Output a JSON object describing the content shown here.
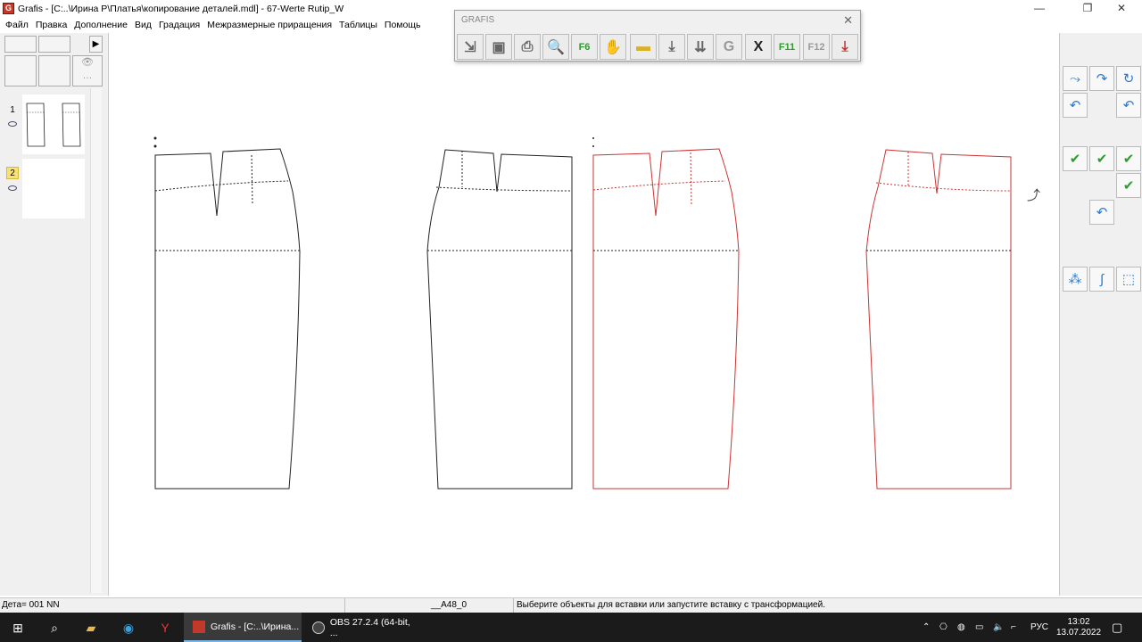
{
  "window": {
    "title": "Grafis - [C:..\\Ирина Р\\Платья\\копирование деталей.mdl] - 67-Werte Rutip_W",
    "app_icon_letter": "G",
    "minimize": "—",
    "restore": "❐",
    "close": "✕"
  },
  "menu": [
    "Файл",
    "Правка",
    "Дополнение",
    "Вид",
    "Градация",
    "Межразмерные приращения",
    "Таблицы",
    "Помощь"
  ],
  "left_panel": {
    "details": [
      {
        "number": "1"
      },
      {
        "number": "2"
      }
    ]
  },
  "toolbar": {
    "title": "GRAFIS",
    "close": "✕",
    "buttons": [
      {
        "icon": "insert-icon",
        "glyph": "⇲"
      },
      {
        "icon": "save-icon",
        "glyph": "▣"
      },
      {
        "icon": "print-icon",
        "glyph": "⎙"
      },
      {
        "icon": "zoom-icon",
        "glyph": "🔍"
      },
      {
        "icon": "fit-f6-icon",
        "glyph": "F6"
      },
      {
        "icon": "hand-icon",
        "glyph": "✋"
      },
      {
        "icon": "ruler-icon",
        "glyph": "▬"
      },
      {
        "icon": "move-down-icon",
        "glyph": "⤓"
      },
      {
        "icon": "move-all-down-icon",
        "glyph": "⇊"
      },
      {
        "icon": "group-icon",
        "glyph": "G"
      },
      {
        "icon": "excel-icon",
        "glyph": "X"
      },
      {
        "icon": "f11-icon",
        "glyph": "F11"
      },
      {
        "icon": "f12-icon",
        "glyph": "F12"
      },
      {
        "icon": "exit-icon",
        "glyph": "⤓"
      }
    ]
  },
  "right_panel": {
    "buttons": [
      {
        "name": "transform-points-button",
        "glyph": "⤳"
      },
      {
        "name": "transform-line-button",
        "glyph": "↷"
      },
      {
        "name": "transform-contour-button",
        "glyph": "↻"
      },
      {
        "name": "undo-rotate-button",
        "glyph": "↶"
      },
      {
        "name": "undo-rotate-right-button",
        "glyph": "↶"
      },
      {
        "name": "accept-button",
        "glyph": "✔"
      },
      {
        "name": "accept-points-button",
        "glyph": "✔"
      },
      {
        "name": "accept-curve-button",
        "glyph": "✔"
      },
      {
        "name": "accept-blue-button",
        "glyph": "✔"
      },
      {
        "name": "undo-button",
        "glyph": "↶"
      },
      {
        "name": "point-tool-button",
        "glyph": "⁂"
      },
      {
        "name": "line-tool-button",
        "glyph": "∫"
      },
      {
        "name": "piece-tool-button",
        "glyph": "⬚"
      }
    ]
  },
  "colors": {
    "normal_outline": "#222222",
    "selected_outline": "#cc3333",
    "accent": "#2a7ad1"
  },
  "status": {
    "detail": "Дета= 001  NN",
    "size": "__A48_0",
    "hint": "Выберите объекты для вставки или запустите вставку с трансформацией."
  },
  "taskbar": {
    "apps": [
      {
        "name": "grafis-taskbar-button",
        "label": "Grafis - [C:..\\Ирина..."
      },
      {
        "name": "obs-taskbar-button",
        "label": "OBS 27.2.4 (64-bit, ..."
      }
    ],
    "lang": "РУС",
    "time": "13:02",
    "date": "13.07.2022"
  }
}
